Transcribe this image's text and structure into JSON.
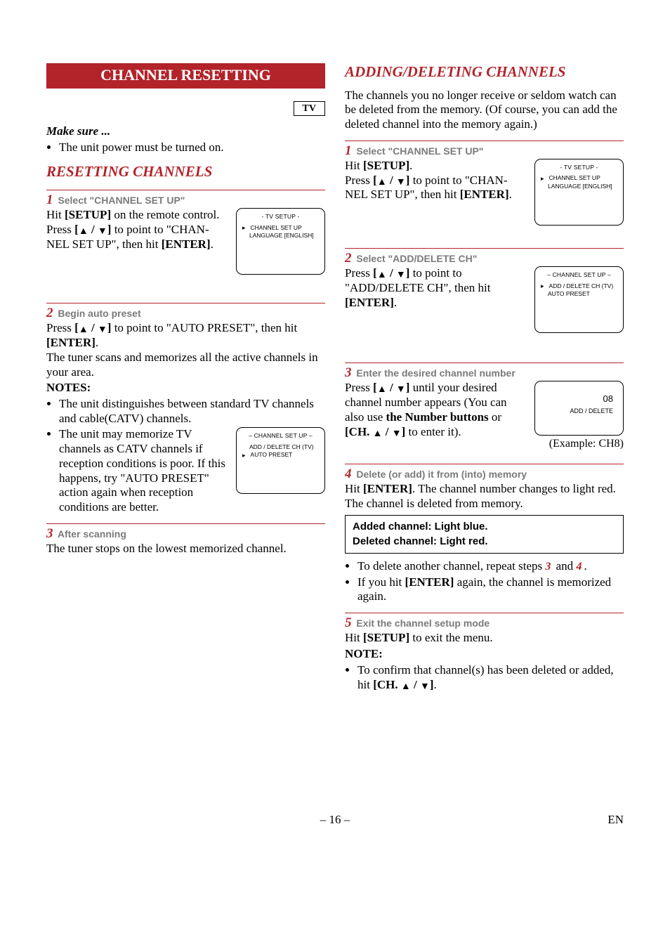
{
  "left": {
    "title": "CHANNEL RESETTING",
    "tv_badge": "TV",
    "make_sure_label": "Make sure ...",
    "make_sure_items": [
      "The unit power must be turned on."
    ],
    "section_a_title": "RESETTING CHANNELS",
    "step1": {
      "num": "1",
      "head": "Select \"CHANNEL SET UP\"",
      "l1a": "Hit ",
      "l1b": "[SETUP]",
      "l1c": " on the remote control.",
      "l2a": "Press ",
      "l2b": "[",
      "up": "▲",
      "slash": " / ",
      "down": "▼",
      "l2c": "]",
      "l2d": " to point to \"CHAN-",
      "l3a": "NEL SET UP\", then hit ",
      "l3b": "[ENTER]",
      "l3c": ".",
      "osd": {
        "title": "- TV SETUP -",
        "line1": "CHANNEL SET UP",
        "line2": "LANGUAGE  [ENGLISH]"
      }
    },
    "step2": {
      "num": "2",
      "head": "Begin auto preset",
      "l1a": "Press ",
      "l1b": "[",
      "up": "▲",
      "slash": " / ",
      "down": "▼",
      "l1c": "]",
      "l1d": " to point to \"AUTO PRESET\", then hit ",
      "l2a": "[ENTER]",
      "l2b": ".",
      "l3": "The tuner scans and memorizes all the active channels in your area.",
      "notes_label": "NOTES:",
      "notes": [
        "The unit distinguishes between standard TV channels and cable(CATV) channels.",
        ""
      ],
      "note2_pre": "The unit may memorize TV channels as CATV channels if reception conditions is poor. If this happens, try \"AUTO PRESET\" action again when reception conditions are better.",
      "osd": {
        "title": "– CHANNEL SET UP –",
        "line1": "ADD / DELETE CH (TV)",
        "line2": "AUTO PRESET"
      }
    },
    "step3": {
      "num": "3",
      "head": "After scanning",
      "l1": "The tuner stops on the lowest memorized channel."
    }
  },
  "right": {
    "section_title": "ADDING/DELETING CHANNELS",
    "lead": "The channels you no longer receive or seldom watch can be deleted from the memory. (Of course, you can add the deleted channel into the memory again.)",
    "step1": {
      "num": "1",
      "head": "Select \"CHANNEL SET UP\"",
      "l1a": "Hit ",
      "l1b": "[SETUP]",
      "l1c": ".",
      "l2a": "Press ",
      "l2b": "[",
      "up": "▲",
      "slash": " / ",
      "down": "▼",
      "l2c": "]",
      "l2d": " to point to \"CHAN-",
      "l3a": "NEL SET UP\", then hit ",
      "l3b": "[ENTER]",
      "l3c": ".",
      "osd": {
        "title": "- TV SETUP -",
        "line1": "CHANNEL SET UP",
        "line2": "LANGUAGE  [ENGLISH]"
      }
    },
    "step2": {
      "num": "2",
      "head": "Select \"ADD/DELETE CH\"",
      "l1a": "Press ",
      "l1b": "[",
      "up": "▲",
      "slash": " / ",
      "down": "▼",
      "l1c": "]",
      "l1d": " to point to",
      "l2": "\"ADD/DELETE CH\", then hit ",
      "l3a": "[ENTER]",
      "l3b": ".",
      "osd": {
        "title": "– CHANNEL SET UP –",
        "line1": "ADD / DELETE CH (TV)",
        "line2": "AUTO PRESET"
      }
    },
    "step3": {
      "num": "3",
      "head": "Enter the desired channel number",
      "l1a": "Press ",
      "l1b": "[",
      "up": "▲",
      "slash": " / ",
      "down": "▼",
      "l1c": "]",
      "l1d": " until your desired channel number appears (You can also use ",
      "l1e": "the Number buttons",
      "l1f": " or ",
      "l2a": "[CH. ",
      "up2": "▲",
      "slash2": " / ",
      "down2": "▼",
      "l2b": "]",
      "l2c": " to enter it).",
      "osd": {
        "num": "08",
        "label": "ADD / DELETE"
      },
      "example": "(Example: CH8)"
    },
    "step4": {
      "num": "4",
      "head": "Delete (or add) it from (into) memory",
      "l1a": "Hit ",
      "l1b": "[ENTER]",
      "l1c": ". The channel number changes to light red. The channel is deleted from memory.",
      "box_line1": "Added channel: Light blue.",
      "box_line2": "Deleted channel: Light red.",
      "bullets_a1": "To delete another channel, repeat steps ",
      "bullets_a2": "3",
      "bullets_a3": " and ",
      "bullets_a4": "4",
      "bullets_a5": ".",
      "bullets_b1": "If you hit ",
      "bullets_b2": "[ENTER]",
      "bullets_b3": " again, the channel is memorized again."
    },
    "step5": {
      "num": "5",
      "head": "Exit the channel setup mode",
      "l1a": "Hit ",
      "l1b": "[SETUP]",
      "l1c": " to exit the menu.",
      "note_label": "NOTE:",
      "note_a": "To confirm that channel(s) has been deleted or added, hit ",
      "note_b": "[CH. ",
      "up": "▲",
      "slash": " / ",
      "down": "▼",
      "note_c": "]",
      "note_d": "."
    }
  },
  "footer": {
    "page": "– 16 –",
    "lang": "EN"
  }
}
